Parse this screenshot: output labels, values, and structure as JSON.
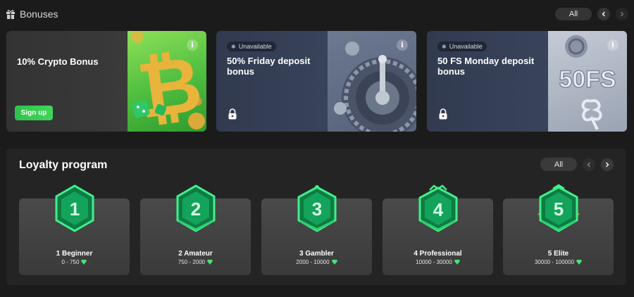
{
  "bonuses": {
    "title": "Bonuses",
    "all_label": "All",
    "cards": [
      {
        "title": "10% Crypto Bonus",
        "button_label": "Sign up"
      },
      {
        "badge": "Unavailable",
        "title": "50% Friday deposit bonus"
      },
      {
        "badge": "Unavailable",
        "title": "50 FS Monday deposit bonus",
        "art_text": "50FS"
      }
    ],
    "info_label": "i"
  },
  "loyalty": {
    "title": "Loyalty program",
    "all_label": "All",
    "levels": [
      {
        "number": "1",
        "name": "1 Beginner",
        "range": "0 - 750"
      },
      {
        "number": "2",
        "name": "2 Amateur",
        "range": "750 - 2000"
      },
      {
        "number": "3",
        "name": "3 Gambler",
        "range": "2000 - 10000"
      },
      {
        "number": "4",
        "name": "4 Professional",
        "range": "10000 - 30000"
      },
      {
        "number": "5",
        "name": "5 Elite",
        "range": "30000 - 100000"
      }
    ]
  },
  "colors": {
    "accent_green": "#3fd65a",
    "badge_green": "#1faf5a",
    "card_blue": "#39435b",
    "background": "#1b1b1b"
  }
}
